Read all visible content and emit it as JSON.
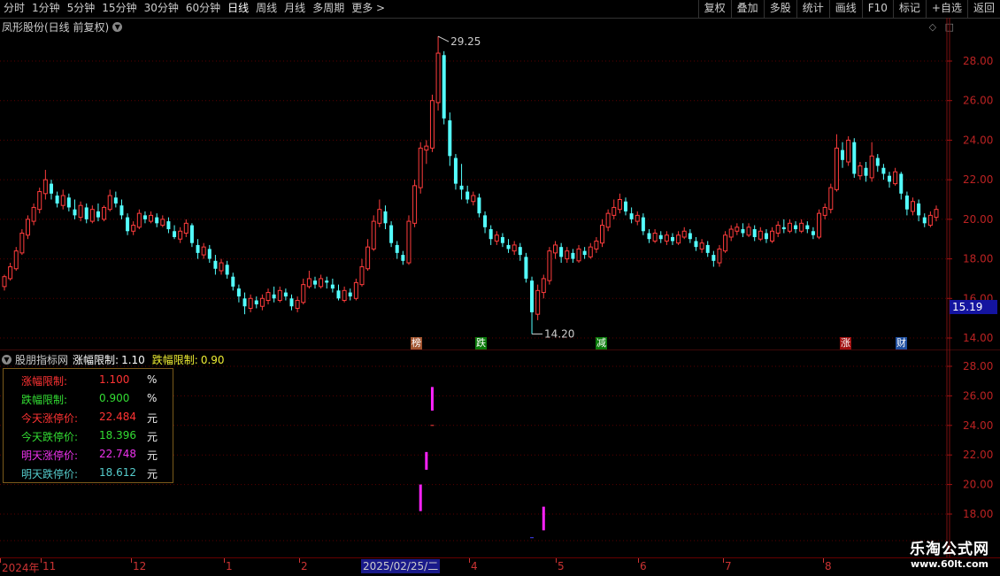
{
  "toolbar": {
    "periods": [
      "分时",
      "1分钟",
      "5分钟",
      "15分钟",
      "30分钟",
      "60分钟",
      "日线",
      "周线",
      "月线",
      "多周期",
      "更多 >"
    ],
    "active": "日线",
    "right": [
      "复权",
      "叠加",
      "多股",
      "统计",
      "画线",
      "F10",
      "标记",
      "+自选",
      "返回"
    ]
  },
  "main_title": "凤形股份(日线 前复权)",
  "main_axis": {
    "ticks": [
      "28.00",
      "26.00",
      "24.00",
      "22.00",
      "20.00",
      "18.00",
      "16.00",
      "14.00"
    ]
  },
  "current_price": "15.19",
  "high_label": "29.25",
  "low_label": "14.20",
  "flags": [
    {
      "text": "榜",
      "color": "#a0522d"
    },
    {
      "text": "跌",
      "color": "#0a7a0a"
    },
    {
      "text": "减",
      "color": "#0a7a0a"
    },
    {
      "text": "涨",
      "color": "#a01010"
    },
    {
      "text": "财",
      "color": "#1f4f9f"
    }
  ],
  "sub_title": {
    "name": "股朋指标网",
    "up_label": "涨幅限制:",
    "up_value": "1.10",
    "down_label": "跌幅限制:",
    "down_value": "0.90"
  },
  "info_box": [
    {
      "label": "涨幅限制:",
      "value": "1.100",
      "unit": "%",
      "label_color": "#ff3333",
      "value_color": "#ff3333"
    },
    {
      "label": "跌幅限制:",
      "value": "0.900",
      "unit": "%",
      "label_color": "#33dd33",
      "value_color": "#33dd33"
    },
    {
      "label": "今天涨停价:",
      "value": "22.484",
      "unit": "元",
      "label_color": "#ff3333",
      "value_color": "#ff3333"
    },
    {
      "label": "今天跌停价:",
      "value": "18.396",
      "unit": "元",
      "label_color": "#33dd33",
      "value_color": "#33dd33"
    },
    {
      "label": "明天涨停价:",
      "value": "22.748",
      "unit": "元",
      "label_color": "#ee33ee",
      "value_color": "#ee33ee"
    },
    {
      "label": "明天跌停价:",
      "value": "18.612",
      "unit": "元",
      "label_color": "#55cccc",
      "value_color": "#55cccc"
    }
  ],
  "sub_axis": {
    "ticks": [
      "28.00",
      "26.00",
      "24.00",
      "22.00",
      "20.00",
      "18.00"
    ]
  },
  "bottom_dates": [
    "2024年",
    "11",
    "12",
    "1",
    "2",
    "2025/02/25/二",
    "4",
    "5",
    "6",
    "7",
    "8"
  ],
  "logo": {
    "name": "乐淘公式网",
    "url": "www.60lt.com"
  },
  "chart_data": {
    "type": "candlestick",
    "title": "凤形股份(日线 前复权)",
    "ylim": [
      13.5,
      29.5
    ],
    "y_ticks": [
      14,
      16,
      18,
      20,
      22,
      24,
      26,
      28
    ],
    "high": 29.25,
    "low": 14.2,
    "current": 15.19,
    "candles": [
      [
        16.6,
        17.1,
        16.4,
        17.2
      ],
      [
        17.0,
        17.6,
        16.9,
        17.8
      ],
      [
        17.5,
        18.4,
        17.4,
        18.6
      ],
      [
        18.3,
        19.3,
        18.2,
        19.5
      ],
      [
        19.2,
        20.0,
        19.0,
        20.2
      ],
      [
        19.9,
        20.6,
        19.7,
        20.8
      ],
      [
        20.5,
        21.4,
        20.3,
        21.6
      ],
      [
        21.3,
        22.0,
        21.0,
        22.5
      ],
      [
        21.8,
        21.3,
        21.0,
        22.0
      ],
      [
        21.2,
        20.8,
        20.6,
        21.4
      ],
      [
        20.7,
        21.2,
        20.5,
        21.5
      ],
      [
        21.1,
        20.6,
        20.4,
        21.3
      ],
      [
        20.5,
        20.2,
        20.0,
        21.0
      ],
      [
        20.1,
        20.7,
        19.9,
        20.9
      ],
      [
        20.6,
        20.0,
        19.8,
        20.8
      ],
      [
        19.9,
        20.5,
        19.8,
        20.7
      ],
      [
        20.4,
        20.1,
        19.9,
        20.8
      ],
      [
        20.0,
        20.6,
        19.9,
        20.7
      ],
      [
        20.5,
        21.2,
        20.4,
        21.5
      ],
      [
        21.1,
        20.8,
        20.6,
        21.4
      ],
      [
        20.7,
        20.2,
        20.0,
        21.0
      ],
      [
        20.1,
        19.4,
        19.2,
        20.3
      ],
      [
        19.4,
        19.7,
        19.2,
        19.9
      ],
      [
        19.6,
        20.3,
        19.5,
        20.5
      ],
      [
        20.2,
        20.0,
        19.8,
        20.4
      ],
      [
        19.9,
        20.2,
        19.8,
        20.4
      ],
      [
        20.1,
        19.8,
        19.6,
        20.3
      ],
      [
        19.7,
        20.0,
        19.6,
        20.2
      ],
      [
        19.9,
        19.5,
        19.3,
        20.1
      ],
      [
        19.4,
        19.1,
        19.0,
        19.7
      ],
      [
        19.0,
        19.4,
        18.8,
        19.6
      ],
      [
        19.3,
        19.8,
        19.1,
        20.0
      ],
      [
        19.7,
        18.8,
        18.6,
        19.8
      ],
      [
        18.7,
        18.3,
        18.0,
        19.0
      ],
      [
        18.2,
        18.6,
        18.0,
        18.8
      ],
      [
        18.5,
        18.0,
        17.8,
        18.7
      ],
      [
        17.9,
        17.5,
        17.2,
        18.2
      ],
      [
        17.4,
        17.8,
        17.2,
        18.0
      ],
      [
        17.7,
        17.2,
        17.0,
        17.9
      ],
      [
        17.1,
        16.6,
        16.4,
        17.3
      ],
      [
        16.5,
        16.1,
        15.8,
        16.7
      ],
      [
        16.0,
        15.6,
        15.2,
        16.3
      ],
      [
        15.5,
        16.0,
        15.3,
        16.2
      ],
      [
        15.9,
        15.7,
        15.5,
        16.1
      ],
      [
        15.6,
        16.0,
        15.4,
        16.2
      ],
      [
        15.9,
        16.3,
        15.7,
        16.5
      ],
      [
        16.2,
        16.0,
        15.8,
        16.6
      ],
      [
        15.9,
        16.4,
        15.8,
        16.6
      ],
      [
        16.3,
        16.1,
        15.9,
        16.5
      ],
      [
        16.0,
        15.6,
        15.4,
        16.2
      ],
      [
        15.5,
        15.9,
        15.3,
        16.1
      ],
      [
        15.8,
        16.7,
        15.7,
        17.0
      ],
      [
        16.6,
        17.0,
        16.5,
        17.4
      ],
      [
        16.9,
        16.7,
        16.5,
        17.1
      ],
      [
        16.6,
        17.0,
        16.5,
        17.2
      ],
      [
        16.9,
        16.8,
        16.5,
        17.1
      ],
      [
        16.7,
        16.5,
        16.3,
        17.0
      ],
      [
        16.4,
        16.0,
        15.9,
        16.7
      ],
      [
        15.9,
        16.4,
        15.8,
        16.6
      ],
      [
        16.3,
        16.1,
        15.9,
        16.5
      ],
      [
        16.0,
        16.8,
        15.9,
        17.0
      ],
      [
        16.7,
        17.6,
        16.6,
        18.0
      ],
      [
        17.5,
        18.6,
        17.4,
        19.0
      ],
      [
        18.5,
        19.9,
        18.4,
        20.2
      ],
      [
        19.8,
        20.5,
        19.6,
        21.0
      ],
      [
        20.4,
        19.8,
        19.5,
        20.7
      ],
      [
        19.7,
        18.8,
        18.6,
        19.9
      ],
      [
        18.7,
        18.3,
        18.0,
        18.9
      ],
      [
        18.2,
        17.9,
        17.7,
        18.4
      ],
      [
        17.8,
        19.9,
        17.7,
        20.2
      ],
      [
        19.8,
        21.7,
        19.6,
        22.0
      ],
      [
        21.6,
        23.6,
        21.3,
        23.9
      ],
      [
        23.5,
        23.7,
        22.8,
        24.0
      ],
      [
        23.6,
        26.0,
        23.4,
        26.3
      ],
      [
        25.9,
        28.4,
        25.5,
        29.25
      ],
      [
        28.3,
        25.1,
        24.8,
        28.5
      ],
      [
        25.0,
        23.2,
        22.7,
        25.4
      ],
      [
        23.1,
        21.8,
        21.5,
        23.3
      ],
      [
        21.7,
        21.5,
        21.0,
        22.8
      ],
      [
        21.4,
        21.0,
        20.8,
        21.7
      ],
      [
        20.9,
        21.2,
        20.7,
        21.4
      ],
      [
        21.1,
        20.3,
        20.1,
        21.3
      ],
      [
        20.2,
        19.6,
        19.3,
        20.4
      ],
      [
        19.5,
        19.0,
        18.7,
        19.7
      ],
      [
        18.9,
        19.2,
        18.7,
        19.4
      ],
      [
        19.1,
        18.8,
        18.6,
        19.3
      ],
      [
        18.7,
        18.5,
        18.3,
        19.0
      ],
      [
        18.4,
        18.7,
        18.2,
        18.9
      ],
      [
        18.6,
        18.2,
        17.9,
        18.8
      ],
      [
        18.1,
        17.0,
        16.8,
        18.3
      ],
      [
        16.9,
        15.3,
        14.2,
        17.1
      ],
      [
        15.2,
        16.4,
        14.9,
        16.7
      ],
      [
        16.3,
        17.0,
        16.0,
        17.2
      ],
      [
        16.9,
        18.4,
        16.7,
        18.6
      ],
      [
        18.3,
        18.7,
        18.0,
        18.9
      ],
      [
        18.6,
        18.1,
        17.8,
        18.8
      ],
      [
        18.0,
        18.4,
        17.8,
        18.6
      ],
      [
        18.3,
        18.0,
        17.8,
        18.5
      ],
      [
        17.9,
        18.5,
        17.8,
        18.7
      ],
      [
        18.4,
        18.2,
        18.0,
        18.6
      ],
      [
        18.1,
        18.6,
        18.0,
        18.8
      ],
      [
        18.5,
        18.9,
        18.3,
        19.1
      ],
      [
        18.8,
        19.7,
        18.6,
        20.0
      ],
      [
        19.6,
        20.3,
        19.4,
        20.5
      ],
      [
        20.2,
        20.6,
        20.0,
        21.0
      ],
      [
        20.5,
        21.0,
        20.3,
        21.3
      ],
      [
        20.9,
        20.4,
        20.2,
        21.1
      ],
      [
        20.3,
        20.0,
        19.8,
        20.6
      ],
      [
        19.9,
        20.2,
        19.7,
        20.4
      ],
      [
        20.1,
        19.4,
        19.2,
        20.3
      ],
      [
        19.3,
        19.0,
        18.8,
        19.5
      ],
      [
        18.9,
        19.3,
        18.8,
        19.5
      ],
      [
        19.2,
        19.0,
        18.8,
        19.4
      ],
      [
        18.9,
        19.2,
        18.7,
        19.4
      ],
      [
        19.1,
        18.9,
        18.7,
        19.3
      ],
      [
        18.8,
        19.2,
        18.7,
        19.4
      ],
      [
        19.1,
        19.4,
        19.0,
        19.6
      ],
      [
        19.3,
        19.0,
        18.8,
        19.5
      ],
      [
        18.9,
        18.6,
        18.4,
        19.1
      ],
      [
        18.5,
        18.8,
        18.3,
        19.0
      ],
      [
        18.7,
        18.3,
        18.1,
        18.9
      ],
      [
        18.2,
        17.9,
        17.6,
        18.4
      ],
      [
        17.8,
        18.5,
        17.6,
        18.7
      ],
      [
        18.4,
        19.2,
        18.3,
        19.4
      ],
      [
        19.1,
        19.5,
        18.9,
        19.7
      ],
      [
        19.4,
        19.6,
        19.2,
        19.8
      ],
      [
        19.5,
        19.3,
        19.1,
        19.8
      ],
      [
        19.2,
        19.6,
        19.1,
        19.8
      ],
      [
        19.5,
        19.1,
        18.9,
        19.7
      ],
      [
        19.0,
        19.4,
        18.9,
        19.6
      ],
      [
        19.3,
        19.0,
        18.8,
        19.5
      ],
      [
        18.9,
        19.4,
        18.8,
        19.6
      ],
      [
        19.3,
        19.7,
        19.1,
        19.9
      ],
      [
        19.6,
        19.5,
        19.3,
        20.0
      ],
      [
        19.4,
        19.8,
        19.3,
        20.0
      ],
      [
        19.7,
        19.5,
        19.3,
        19.9
      ],
      [
        19.4,
        19.8,
        19.3,
        20.0
      ],
      [
        19.7,
        19.5,
        19.3,
        19.9
      ],
      [
        19.4,
        19.2,
        19.0,
        19.6
      ],
      [
        19.1,
        20.3,
        19.0,
        20.5
      ],
      [
        20.2,
        20.6,
        20.0,
        20.8
      ],
      [
        20.5,
        21.6,
        20.3,
        21.8
      ],
      [
        21.5,
        23.6,
        21.4,
        24.3
      ],
      [
        23.5,
        23.0,
        22.6,
        23.9
      ],
      [
        22.9,
        24.0,
        22.7,
        24.2
      ],
      [
        23.9,
        22.3,
        22.1,
        24.1
      ],
      [
        22.2,
        22.7,
        22.0,
        22.9
      ],
      [
        22.6,
        22.2,
        21.9,
        22.9
      ],
      [
        22.1,
        23.2,
        21.9,
        23.9
      ],
      [
        23.1,
        22.7,
        22.4,
        23.3
      ],
      [
        22.6,
        22.3,
        22.0,
        22.8
      ],
      [
        22.2,
        21.9,
        21.6,
        22.4
      ],
      [
        21.8,
        22.4,
        21.7,
        22.6
      ],
      [
        22.3,
        21.3,
        21.0,
        22.4
      ],
      [
        21.2,
        20.5,
        20.2,
        21.4
      ],
      [
        20.4,
        20.9,
        20.2,
        21.1
      ],
      [
        20.8,
        20.2,
        19.9,
        21.0
      ],
      [
        20.1,
        19.8,
        19.6,
        20.3
      ],
      [
        19.7,
        20.2,
        19.6,
        20.4
      ],
      [
        20.1,
        20.5,
        19.9,
        20.7
      ]
    ]
  }
}
